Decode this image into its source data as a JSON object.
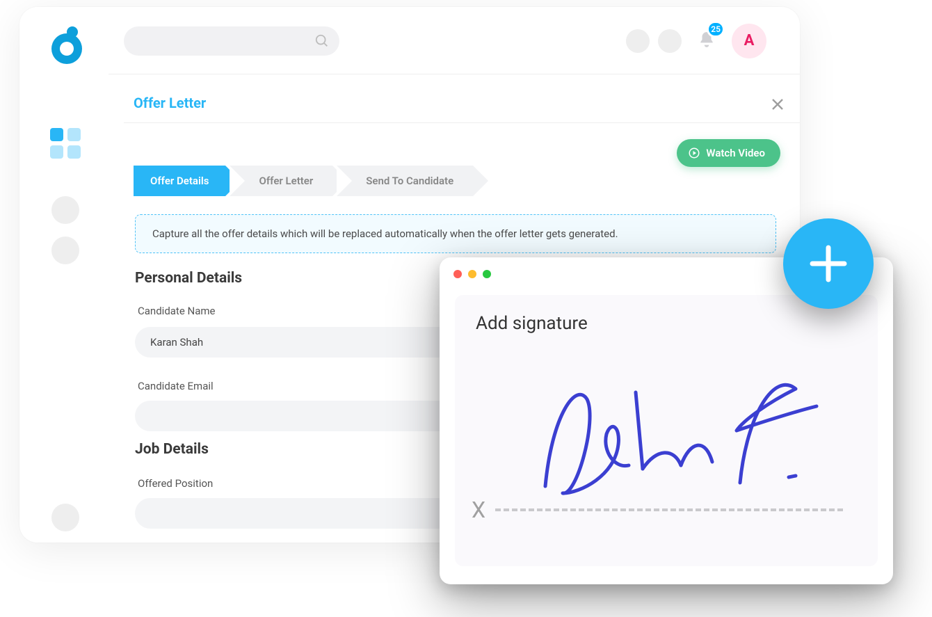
{
  "header": {
    "notification_count": "25",
    "avatar_letter": "A"
  },
  "page": {
    "title": "Offer Letter"
  },
  "steps": {
    "s1": "Offer Details",
    "s2": "Offer Letter",
    "s3": "Send To Candidate"
  },
  "actions": {
    "watch_video": "Watch Video"
  },
  "banner": {
    "text": "Capture all the offer details which will be replaced automatically when the offer letter gets generated."
  },
  "sections": {
    "personal": "Personal Details",
    "job": "Job Details"
  },
  "fields": {
    "candidate_name_label": "Candidate Name",
    "candidate_name_value": "Karan Shah",
    "candidate_email_label": "Candidate Email",
    "candidate_email_value": "",
    "offered_position_label": "Offered Position",
    "offered_position_value": ""
  },
  "signature": {
    "title": "Add signature",
    "line_marker": "X"
  }
}
